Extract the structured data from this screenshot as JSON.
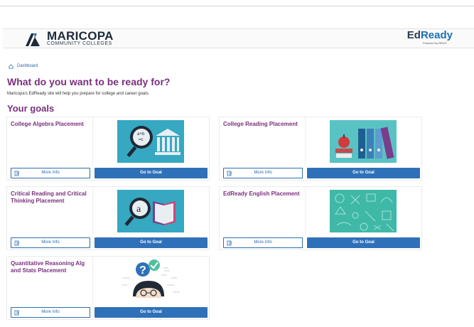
{
  "header": {
    "brand_name": "MARICOPA",
    "brand_subtitle": "COMMUNITY COLLEGES",
    "product_name_prefix": "Ed",
    "product_name_accent": "Ready",
    "product_tagline": "Powered by NROC",
    "brand_color": "#1d2a3a",
    "accent_color": "#1f6fb2"
  },
  "breadcrumb": {
    "label": "Dashboard",
    "icon": "home-icon"
  },
  "page": {
    "title": "What do you want to be ready for?",
    "intro": "Maricopa's EdReady site will help you prepare for college and career goals.",
    "goals_heading": "Your goals",
    "heading_color": "#7a2f7d"
  },
  "goals": [
    {
      "title": "College Algebra Placement",
      "more_info": "More Info",
      "go_to_goal": "Go to Goal",
      "image": "algebra-magnifier-building",
      "image_bg": "#36a8c2"
    },
    {
      "title": "College Reading Placement",
      "more_info": "More Info",
      "go_to_goal": "Go to Goal",
      "image": "apple-books-binders",
      "image_bg": "#59c3c3"
    },
    {
      "title": "Critical Reading and Critical Thinking Placement",
      "more_info": "More Info",
      "go_to_goal": "Go to Goal",
      "image": "magnifier-open-book",
      "image_bg": "#36a8c2"
    },
    {
      "title": "EdReady English Placement",
      "more_info": "More Info",
      "go_to_goal": "Go to Goal",
      "image": "teal-doodle-pattern",
      "image_bg": "#3fb8a8"
    },
    {
      "title": "Quantitative Reasoning Alg and Stats Placement",
      "more_info": "More Info",
      "go_to_goal": "Go to Goal",
      "image": "student-question-check",
      "image_bg": "#ffffff"
    }
  ],
  "button_color": "#2e71b8"
}
